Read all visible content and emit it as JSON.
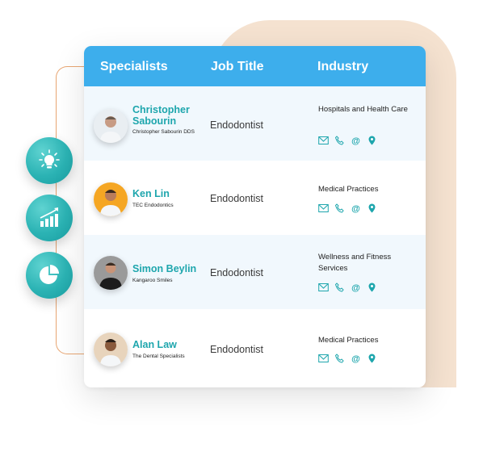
{
  "header": {
    "col_specialists": "Specialists",
    "col_job_title": "Job Title",
    "col_industry": "Industry"
  },
  "feature_icons": [
    "lightbulb-icon",
    "growth-chart-icon",
    "pie-chart-icon"
  ],
  "colors": {
    "header_bg": "#3daeec",
    "name_text": "#1ea6ad",
    "icon_teal": "#1ea6ad",
    "blob": "#f5e2d0",
    "bracket": "#e9a673",
    "alt_row": "#f1f8fd"
  },
  "rows": [
    {
      "name": "Christopher Sabourin",
      "company": "Christopher Sabourin DDS",
      "job_title": "Endodontist",
      "industry": "Hospitals and Health Care",
      "contact_icons": [
        "email-icon",
        "phone-icon",
        "at-icon",
        "location-icon"
      ]
    },
    {
      "name": "Ken Lin",
      "company": "TEC Endodontics",
      "job_title": "Endodontist",
      "industry": "Medical Practices",
      "contact_icons": [
        "email-icon",
        "phone-icon",
        "at-icon",
        "location-icon"
      ]
    },
    {
      "name": "Simon Beylin",
      "company": "Kangaroo Smiles",
      "job_title": "Endodontist",
      "industry": "Wellness and Fitness Services",
      "contact_icons": [
        "email-icon",
        "phone-icon",
        "at-icon",
        "location-icon"
      ]
    },
    {
      "name": "Alan Law",
      "company": "The Dental Specialists",
      "job_title": "Endodontist",
      "industry": "Medical Practices",
      "contact_icons": [
        "email-icon",
        "phone-icon",
        "at-icon",
        "location-icon"
      ]
    }
  ]
}
